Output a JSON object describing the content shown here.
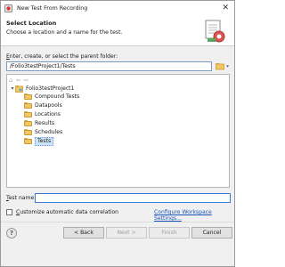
{
  "window": {
    "title": "New Test From Recording",
    "close_glyph": "✕"
  },
  "header": {
    "title": "Select Location",
    "description": "Choose a location and a name for the test."
  },
  "location": {
    "prompt_prefix": "",
    "prompt_mnemonic": "E",
    "prompt_rest": "nter, create, or select the parent folder:",
    "path_value": "/Folio3testProject1/Tests"
  },
  "tree": {
    "project": "Folio3testProject1",
    "folders": [
      "Compound Tests",
      "Datapools",
      "Locations",
      "Results",
      "Schedules",
      "Tests"
    ],
    "selected": "Tests"
  },
  "test_name": {
    "label_mnemonic": "T",
    "label_rest": "est name:",
    "value": ""
  },
  "options": {
    "checkbox_mnemonic": "C",
    "checkbox_rest": "ustomize automatic data correlation",
    "checked": false,
    "configure_link": "Configure Workspace Settings..."
  },
  "buttons": {
    "back": "< Back",
    "next": "Next >",
    "finish": "Finish",
    "cancel": "Cancel"
  },
  "icons": {
    "app": "recorder-icon",
    "banner": "test-wizard-banner-icon",
    "folder": "folder-icon",
    "project": "project-icon",
    "help": "help-icon"
  },
  "colors": {
    "selection": "#cce4f7",
    "link": "#1a55b5",
    "folder": "#f2c766"
  }
}
